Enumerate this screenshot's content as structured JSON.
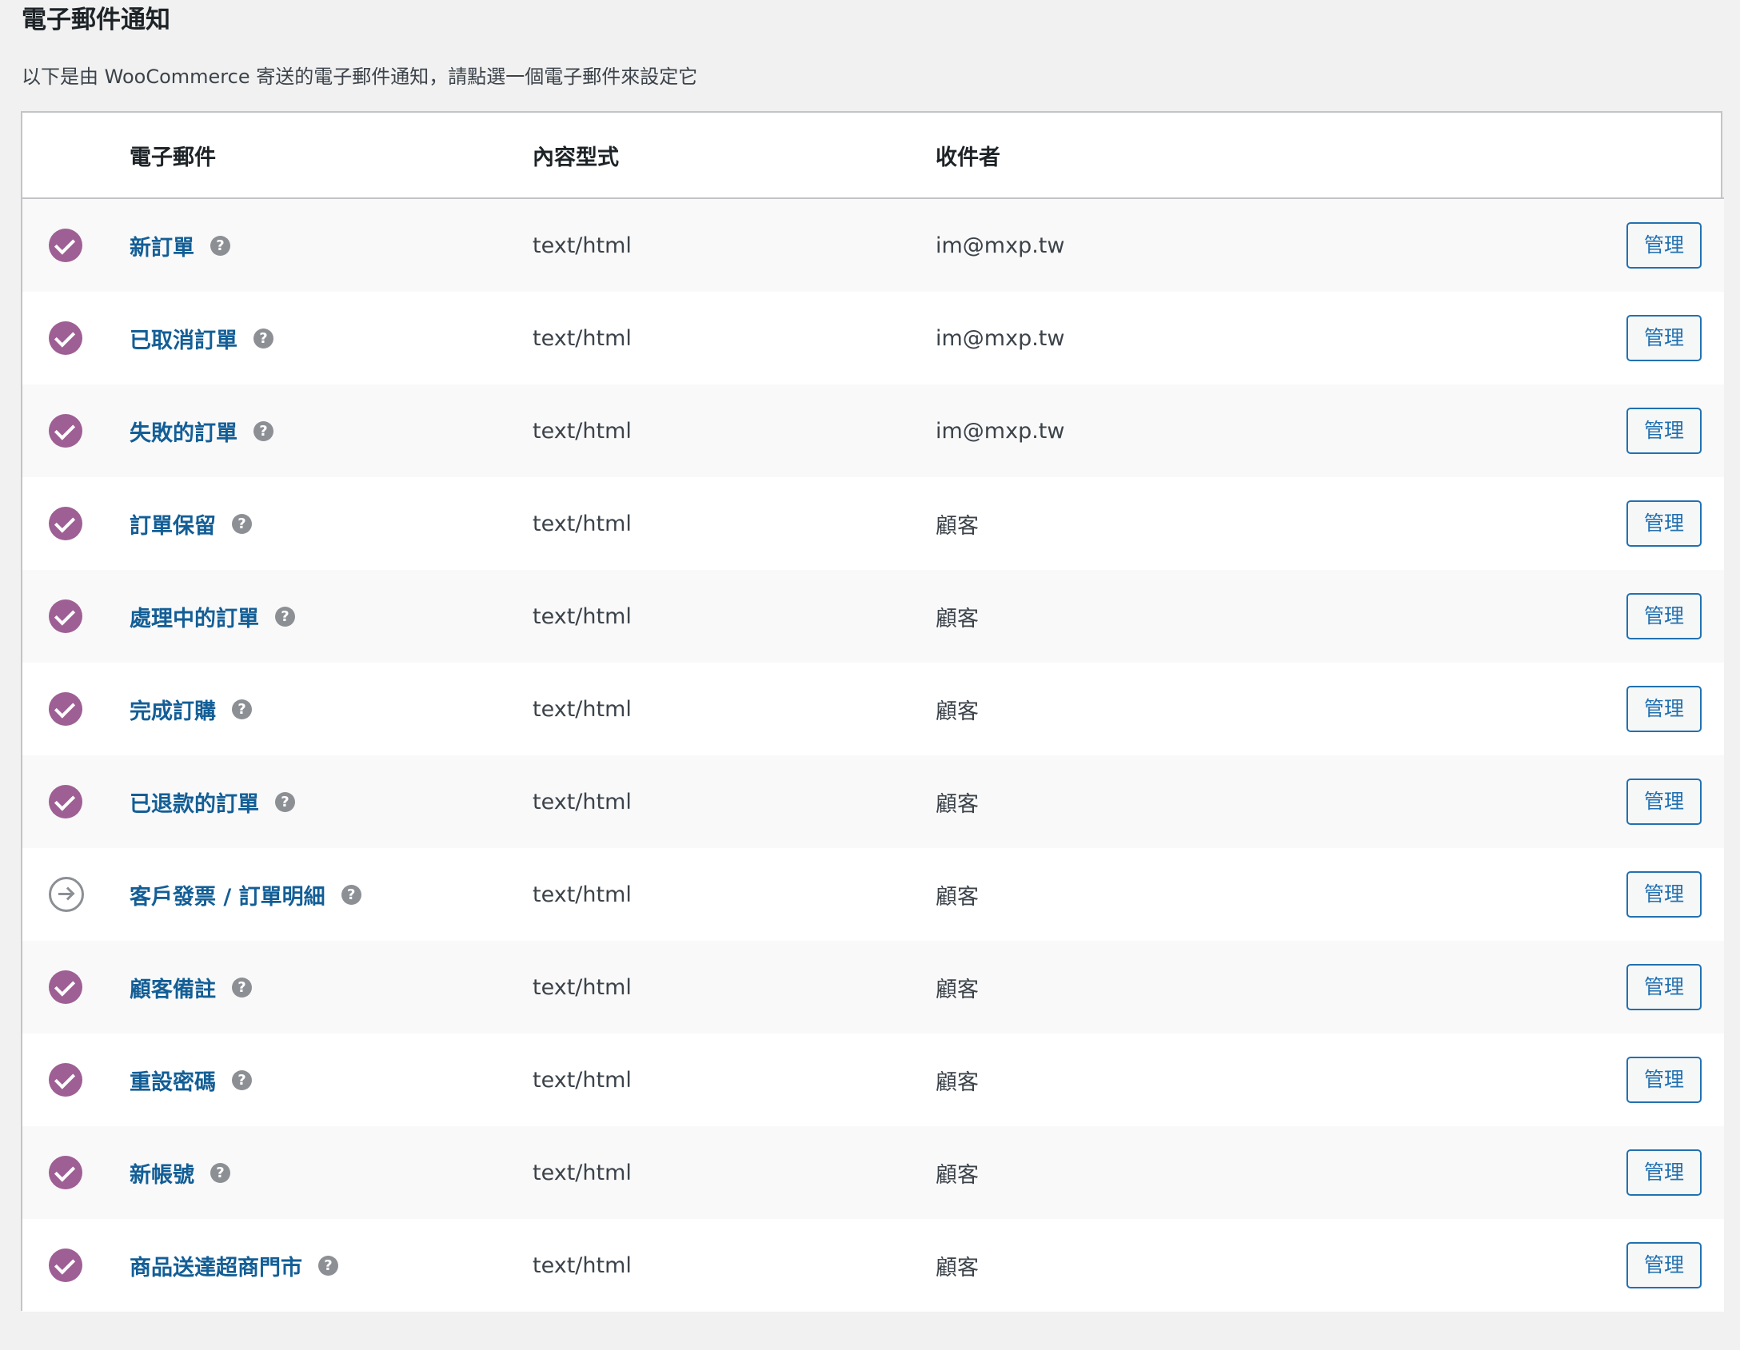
{
  "page": {
    "title": "電子郵件通知",
    "description": "以下是由 WooCommerce 寄送的電子郵件通知，請點選一個電子郵件來設定它"
  },
  "table": {
    "headers": {
      "email": "電子郵件",
      "content_type": "內容型式",
      "recipient": "收件者"
    },
    "rows": [
      {
        "name": "新訂單",
        "status": "enabled",
        "status_icon": "check-circle-icon",
        "content_type": "text/html",
        "recipient": "im@mxp.tw",
        "action": "管理"
      },
      {
        "name": "已取消訂單",
        "status": "enabled",
        "status_icon": "check-circle-icon",
        "content_type": "text/html",
        "recipient": "im@mxp.tw",
        "action": "管理"
      },
      {
        "name": "失敗的訂單",
        "status": "enabled",
        "status_icon": "check-circle-icon",
        "content_type": "text/html",
        "recipient": "im@mxp.tw",
        "action": "管理"
      },
      {
        "name": "訂單保留",
        "status": "enabled",
        "status_icon": "check-circle-icon",
        "content_type": "text/html",
        "recipient": "顧客",
        "action": "管理"
      },
      {
        "name": "處理中的訂單",
        "status": "enabled",
        "status_icon": "check-circle-icon",
        "content_type": "text/html",
        "recipient": "顧客",
        "action": "管理"
      },
      {
        "name": "完成訂購",
        "status": "enabled",
        "status_icon": "check-circle-icon",
        "content_type": "text/html",
        "recipient": "顧客",
        "action": "管理"
      },
      {
        "name": "已退款的訂單",
        "status": "enabled",
        "status_icon": "check-circle-icon",
        "content_type": "text/html",
        "recipient": "顧客",
        "action": "管理"
      },
      {
        "name": "客戶發票 / 訂單明細",
        "status": "manual",
        "status_icon": "arrow-circle-icon",
        "content_type": "text/html",
        "recipient": "顧客",
        "action": "管理"
      },
      {
        "name": "顧客備註",
        "status": "enabled",
        "status_icon": "check-circle-icon",
        "content_type": "text/html",
        "recipient": "顧客",
        "action": "管理"
      },
      {
        "name": "重設密碼",
        "status": "enabled",
        "status_icon": "check-circle-icon",
        "content_type": "text/html",
        "recipient": "顧客",
        "action": "管理"
      },
      {
        "name": "新帳號",
        "status": "enabled",
        "status_icon": "check-circle-icon",
        "content_type": "text/html",
        "recipient": "顧客",
        "action": "管理"
      },
      {
        "name": "商品送達超商門市",
        "status": "enabled",
        "status_icon": "check-circle-icon",
        "content_type": "text/html",
        "recipient": "顧客",
        "action": "管理"
      }
    ]
  },
  "help_glyph": "?",
  "colors": {
    "enabled": "#9e5f94",
    "link": "#135e96",
    "button": "#2271b1",
    "help": "#8c8f94"
  }
}
